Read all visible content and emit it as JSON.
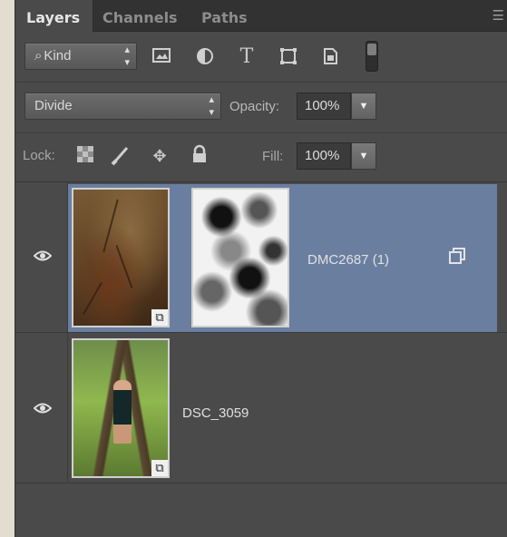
{
  "tabs": [
    {
      "label": "Layers"
    },
    {
      "label": "Channels"
    },
    {
      "label": "Paths"
    }
  ],
  "tab_menu_icon": "panel-menu-icon",
  "filter": {
    "kind_label": "Kind",
    "search_icon": "magnifier-icon",
    "icons": [
      "image-filter-icon",
      "adjustment-filter-icon",
      "type-filter-icon",
      "shape-filter-icon",
      "smart-object-filter-icon"
    ],
    "toggle": "filter-toggle"
  },
  "blend": {
    "mode": "Divide",
    "opacity_label": "Opacity:",
    "opacity_value": "100%"
  },
  "lock": {
    "label": "Lock:",
    "icons": [
      "lock-transparent-icon",
      "lock-image-icon",
      "lock-position-icon",
      "lock-all-icon"
    ],
    "fill_label": "Fill:",
    "fill_value": "100%"
  },
  "layers": [
    {
      "name": "DMC2687 (1)",
      "selected": true,
      "visible": true,
      "has_mask": true
    },
    {
      "name": "DSC_3059",
      "selected": false,
      "visible": true,
      "has_mask": false
    }
  ],
  "colors": {
    "panel_bg": "#4a4a4a",
    "selection": "#6a7fa0",
    "tabbar": "#323232"
  }
}
